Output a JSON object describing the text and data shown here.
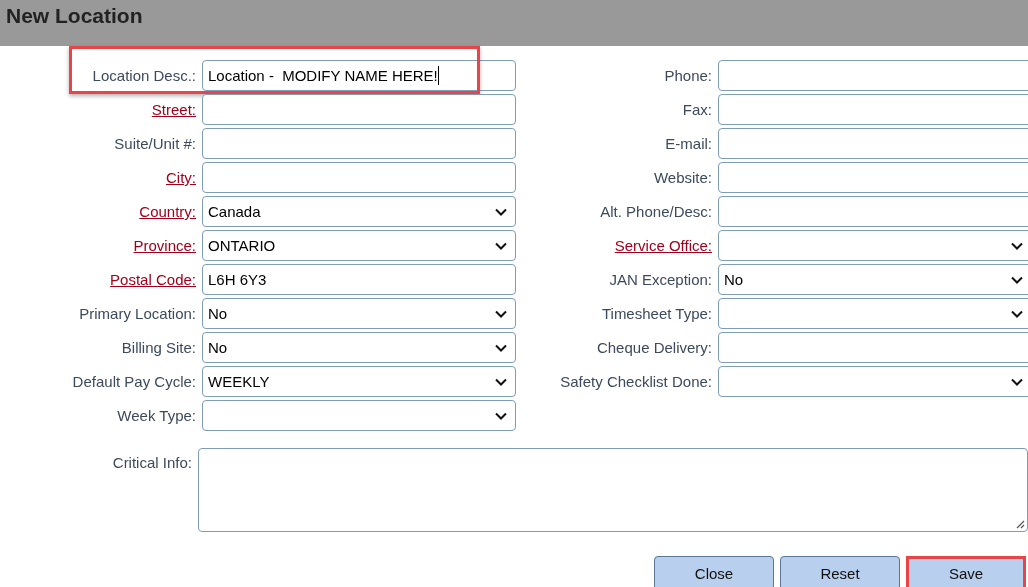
{
  "title": "New Location",
  "left_fields": [
    {
      "label": "Location Desc.:",
      "required": false,
      "kind": "text",
      "value": "Location -  MODIFY NAME HERE!",
      "focused": true,
      "highlighted": true
    },
    {
      "label": "Street:",
      "required": true,
      "kind": "text"
    },
    {
      "label": "Suite/Unit #:",
      "required": false,
      "kind": "text"
    },
    {
      "label": "City:",
      "required": true,
      "kind": "text"
    },
    {
      "label": "Country:",
      "required": true,
      "kind": "select",
      "value": "Canada"
    },
    {
      "label": "Province:",
      "required": true,
      "kind": "select",
      "value": "ONTARIO"
    },
    {
      "label": "Postal Code:",
      "required": true,
      "kind": "text",
      "value": "L6H 6Y3"
    },
    {
      "label": "Primary Location:",
      "required": false,
      "kind": "select",
      "value": "No"
    },
    {
      "label": "Billing Site:",
      "required": false,
      "kind": "select",
      "value": "No"
    },
    {
      "label": "Default Pay Cycle:",
      "required": false,
      "kind": "select",
      "value": "WEEKLY"
    },
    {
      "label": "Week Type:",
      "required": false,
      "kind": "select"
    }
  ],
  "right_fields": [
    {
      "label": "Phone:",
      "required": false,
      "kind": "text"
    },
    {
      "label": "Fax:",
      "required": false,
      "kind": "text"
    },
    {
      "label": "E-mail:",
      "required": false,
      "kind": "text"
    },
    {
      "label": "Website:",
      "required": false,
      "kind": "text"
    },
    {
      "label": "Alt. Phone/Desc:",
      "required": false,
      "kind": "text"
    },
    {
      "label": "Service Office:",
      "required": true,
      "kind": "select"
    },
    {
      "label": "JAN Exception:",
      "required": false,
      "kind": "select",
      "value": "No"
    },
    {
      "label": "Timesheet Type:",
      "required": false,
      "kind": "select"
    },
    {
      "label": "Cheque Delivery:",
      "required": false,
      "kind": "text"
    },
    {
      "label": "Safety Checklist Done:",
      "required": false,
      "kind": "select"
    }
  ],
  "notes": {
    "label": "Critical Info:"
  },
  "buttons": [
    {
      "label": "Close",
      "highlighted": false
    },
    {
      "label": "Reset",
      "highlighted": false
    },
    {
      "label": "Save",
      "highlighted": true
    }
  ]
}
